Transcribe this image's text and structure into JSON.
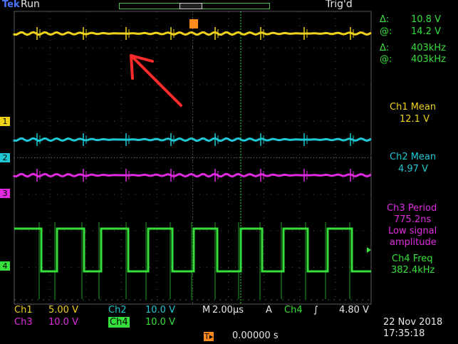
{
  "header": {
    "brand": "Tek",
    "state": "Run",
    "trigger_status": "Trig'd",
    "trigger_pos_marker": "T"
  },
  "measurements": {
    "delta_v": {
      "label": "Δ:",
      "value": "10.8 V"
    },
    "at_v": {
      "label": "@:",
      "value": "14.2 V"
    },
    "delta_f": {
      "label": "Δ:",
      "value": "403kHz"
    },
    "at_f": {
      "label": "@:",
      "value": "403kHz"
    },
    "ch1_mean": {
      "label": "Ch1 Mean",
      "value": "12.1 V"
    },
    "ch2_mean": {
      "label": "Ch2 Mean",
      "value": "4.97 V"
    },
    "ch3_period": {
      "label": "Ch3 Period",
      "value": "775.2ns",
      "note_1": "Low signal",
      "note_2": "amplitude"
    },
    "ch4_freq": {
      "label": "Ch4 Freq",
      "value": "382.4kHz"
    }
  },
  "channels": {
    "ch1": {
      "label": "Ch1",
      "scale": "5.00 V",
      "marker": "1",
      "color": "#f0d21a"
    },
    "ch2": {
      "label": "Ch2",
      "scale": "10.0 V",
      "marker": "2",
      "color": "#1ec8d2"
    },
    "ch3": {
      "label": "Ch3",
      "scale": "10.0 V",
      "marker": "3",
      "color": "#e02adf"
    },
    "ch4": {
      "label": "Ch4",
      "scale": "10.0 V",
      "marker": "4",
      "color": "#35e03a"
    }
  },
  "timebase": {
    "label": "M",
    "value": "2.00µs"
  },
  "trigger": {
    "mode": "A",
    "source": "Ch4",
    "slope": "∫",
    "level": "4.80 V",
    "position_label": "T▸",
    "position": "0.00000 s"
  },
  "datetime": {
    "date": "22 Nov 2018",
    "time": "17:35:18"
  }
}
